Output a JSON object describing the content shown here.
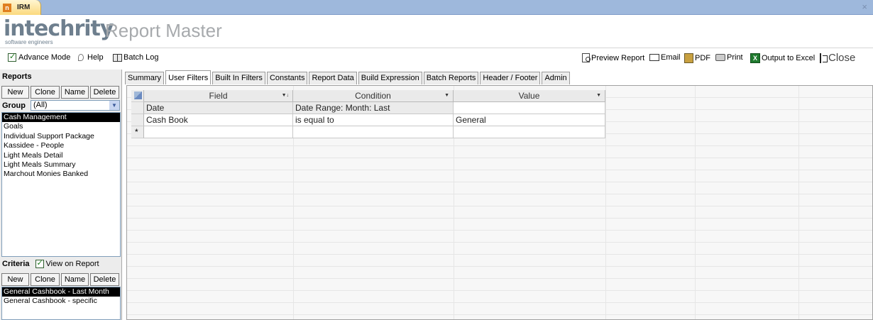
{
  "window": {
    "tab_title": "IRM",
    "tab_icon": "n"
  },
  "header": {
    "logo": "intechrity",
    "logo_sub": "software engineers",
    "app_title": "Report Master"
  },
  "toolbar": {
    "advance_mode": "Advance Mode",
    "help": "Help",
    "batch_log": "Batch Log",
    "preview_report": "Preview Report",
    "email": "Email",
    "pdf": "PDF",
    "print": "Print",
    "output_excel": "Output to Excel",
    "close": "Close",
    "excel_icon_text": "X"
  },
  "reports": {
    "title": "Reports",
    "buttons": [
      "New",
      "Clone",
      "Name",
      "Delete"
    ],
    "group_label": "Group",
    "group_value": "(All)",
    "items": [
      "Cash Management",
      "Goals",
      "Individual Support Package",
      "Kassidee - People",
      "Light Meals Detail",
      "Light Meals Summary",
      "Marchout Monies Banked"
    ],
    "selected_index": 0
  },
  "criteria": {
    "title": "Criteria",
    "view_on_report": "View on Report",
    "buttons": [
      "New",
      "Clone",
      "Name",
      "Delete"
    ],
    "items": [
      "General Cashbook - Last Month",
      "General Cashbook - specific"
    ],
    "selected_index": 0
  },
  "tabs": [
    "Summary",
    "User Filters",
    "Built In Filters",
    "Constants",
    "Report Data",
    "Build Expression",
    "Batch Reports",
    "Header / Footer",
    "Admin"
  ],
  "active_tab": "User Filters",
  "grid": {
    "columns": [
      "Field",
      "Condition",
      "Value"
    ],
    "rows": [
      [
        "Date",
        "Date Range: Month: Last",
        ""
      ],
      [
        "Cash Book",
        "is equal to",
        "General"
      ]
    ],
    "new_row_marker": "*"
  }
}
